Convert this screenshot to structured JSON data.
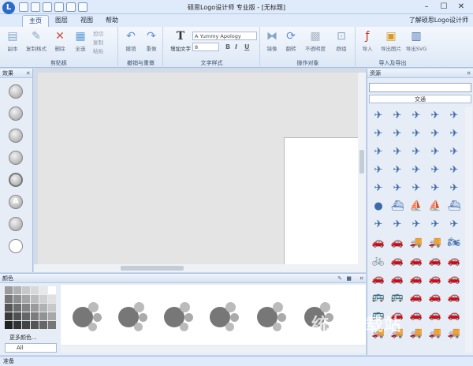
{
  "window": {
    "title": "硕思Logo设计师 专业版 - [无标题]",
    "minimize": "–",
    "maximize": "☐",
    "close": "✕"
  },
  "tabs": [
    "主页",
    "图层",
    "视图",
    "帮助"
  ],
  "about_link": "了解硕思Logo设计师",
  "ribbon": {
    "clipboard": {
      "label": "剪贴板",
      "buttons": [
        "副本",
        "复制格式",
        "删除",
        "全选"
      ],
      "small": [
        "剪切",
        "复制",
        "粘贴"
      ]
    },
    "undo": {
      "label": "撤销与重做",
      "buttons": [
        "撤销",
        "重做"
      ]
    },
    "text": {
      "label": "文字样式",
      "add_text": "增加文字",
      "font": "A Yummy Apology",
      "size": "8",
      "bold": "B",
      "italic": "I",
      "underline": "U"
    },
    "objects": {
      "label": "操作对象",
      "buttons": [
        "镜像",
        "翻转",
        "不透明度",
        "群组"
      ]
    },
    "io": {
      "label": "导入及导出",
      "buttons": [
        "导入",
        "导出图片",
        "导出SVG"
      ]
    }
  },
  "effects_panel": {
    "title": "效果"
  },
  "resources_panel": {
    "title": "资源",
    "search_value": "",
    "category": "交通"
  },
  "colors_panel": {
    "title": "颜色",
    "more_colors": "更多颜色...",
    "filter": "All"
  },
  "statusbar": {
    "text": "准备"
  },
  "watermark": "统一下载站"
}
